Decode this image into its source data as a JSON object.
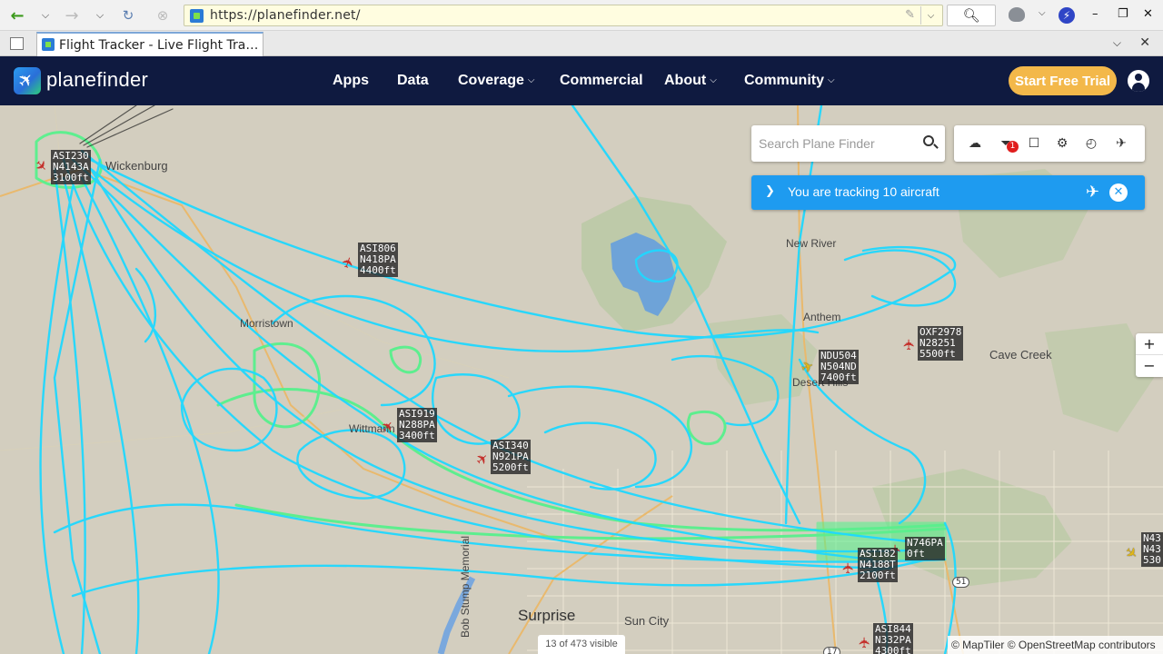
{
  "browser": {
    "url": "https://planefinder.net/",
    "tab_title": "Flight Tracker - Live Flight Trac…"
  },
  "icons": {
    "back": "arrow-left-icon",
    "forward": "arrow-right-icon",
    "reload": "reload-icon",
    "stop": "stop-icon",
    "search": "magnifier-icon",
    "user": "user-circle-icon",
    "filter": "filter-icon",
    "bookmark": "bookmark-icon",
    "settings": "gear-icon",
    "history": "history-icon",
    "layers": "layers-icon",
    "weather": "cloud-icon"
  },
  "header": {
    "logo_text": "planefinder",
    "nav": [
      {
        "label": "Apps"
      },
      {
        "label": "Data"
      },
      {
        "label": "Coverage",
        "dropdown": true
      },
      {
        "label": "Commercial"
      },
      {
        "label": "About",
        "dropdown": true
      },
      {
        "label": "Community",
        "dropdown": true
      }
    ],
    "trial_button": "Start Free Trial"
  },
  "colors": {
    "header_bg": "#0f1a40",
    "trial_btn": "#f3b84a",
    "tracking_bar": "#1e9bf0",
    "track_line": "#1fd8ff",
    "track_line_low": "#57f08c",
    "aircraft": "#c4302b",
    "aircraft_selected": "#e0b718"
  },
  "map_controls": {
    "search_placeholder": "Search Plane Finder",
    "filter_badge": "1",
    "tracking_text": "You are tracking 10 aircraft",
    "zoom_in": "+",
    "zoom_out": "−",
    "visible_count": "13 of 473 visible",
    "attribution": "© MapTiler © OpenStreetMap contributors"
  },
  "places": [
    {
      "name": "Wickenburg",
      "size": "md"
    },
    {
      "name": "New River",
      "size": "sm"
    },
    {
      "name": "Anthem",
      "size": "sm"
    },
    {
      "name": "Cave Creek",
      "size": "md"
    },
    {
      "name": "Morristown",
      "size": "sm"
    },
    {
      "name": "Desert Hills",
      "size": "sm"
    },
    {
      "name": "Wittmann",
      "size": "sm"
    },
    {
      "name": "Surprise",
      "size": "lg"
    },
    {
      "name": "Sun City",
      "size": "md"
    },
    {
      "name": "Bob Stump Memorial",
      "size": "sm"
    }
  ],
  "route_shields": [
    "51",
    "17"
  ],
  "aircraft": [
    {
      "callsign": "ASI230",
      "reg": "N4143A",
      "alt": "3100ft",
      "selected": false
    },
    {
      "callsign": "ASI806",
      "reg": "N418PA",
      "alt": "4400ft",
      "selected": false
    },
    {
      "callsign": "OXF2978",
      "reg": "N28251",
      "alt": "5500ft",
      "selected": false
    },
    {
      "callsign": "NDU504",
      "reg": "N504ND",
      "alt": "7400ft",
      "selected": true
    },
    {
      "callsign": "ASI919",
      "reg": "N288PA",
      "alt": "3400ft",
      "selected": false
    },
    {
      "callsign": "ASI340",
      "reg": "N921PA",
      "alt": "5200ft",
      "selected": false
    },
    {
      "callsign": "",
      "reg": "N746PA",
      "alt": "0ft",
      "selected": false
    },
    {
      "callsign": "ASI182",
      "reg": "N4188T",
      "alt": "2100ft",
      "selected": false
    },
    {
      "callsign": "ASI844",
      "reg": "N332PA",
      "alt": "4300ft",
      "selected": false
    },
    {
      "callsign": "N43",
      "reg": "N43",
      "alt": "530",
      "selected": true
    }
  ]
}
